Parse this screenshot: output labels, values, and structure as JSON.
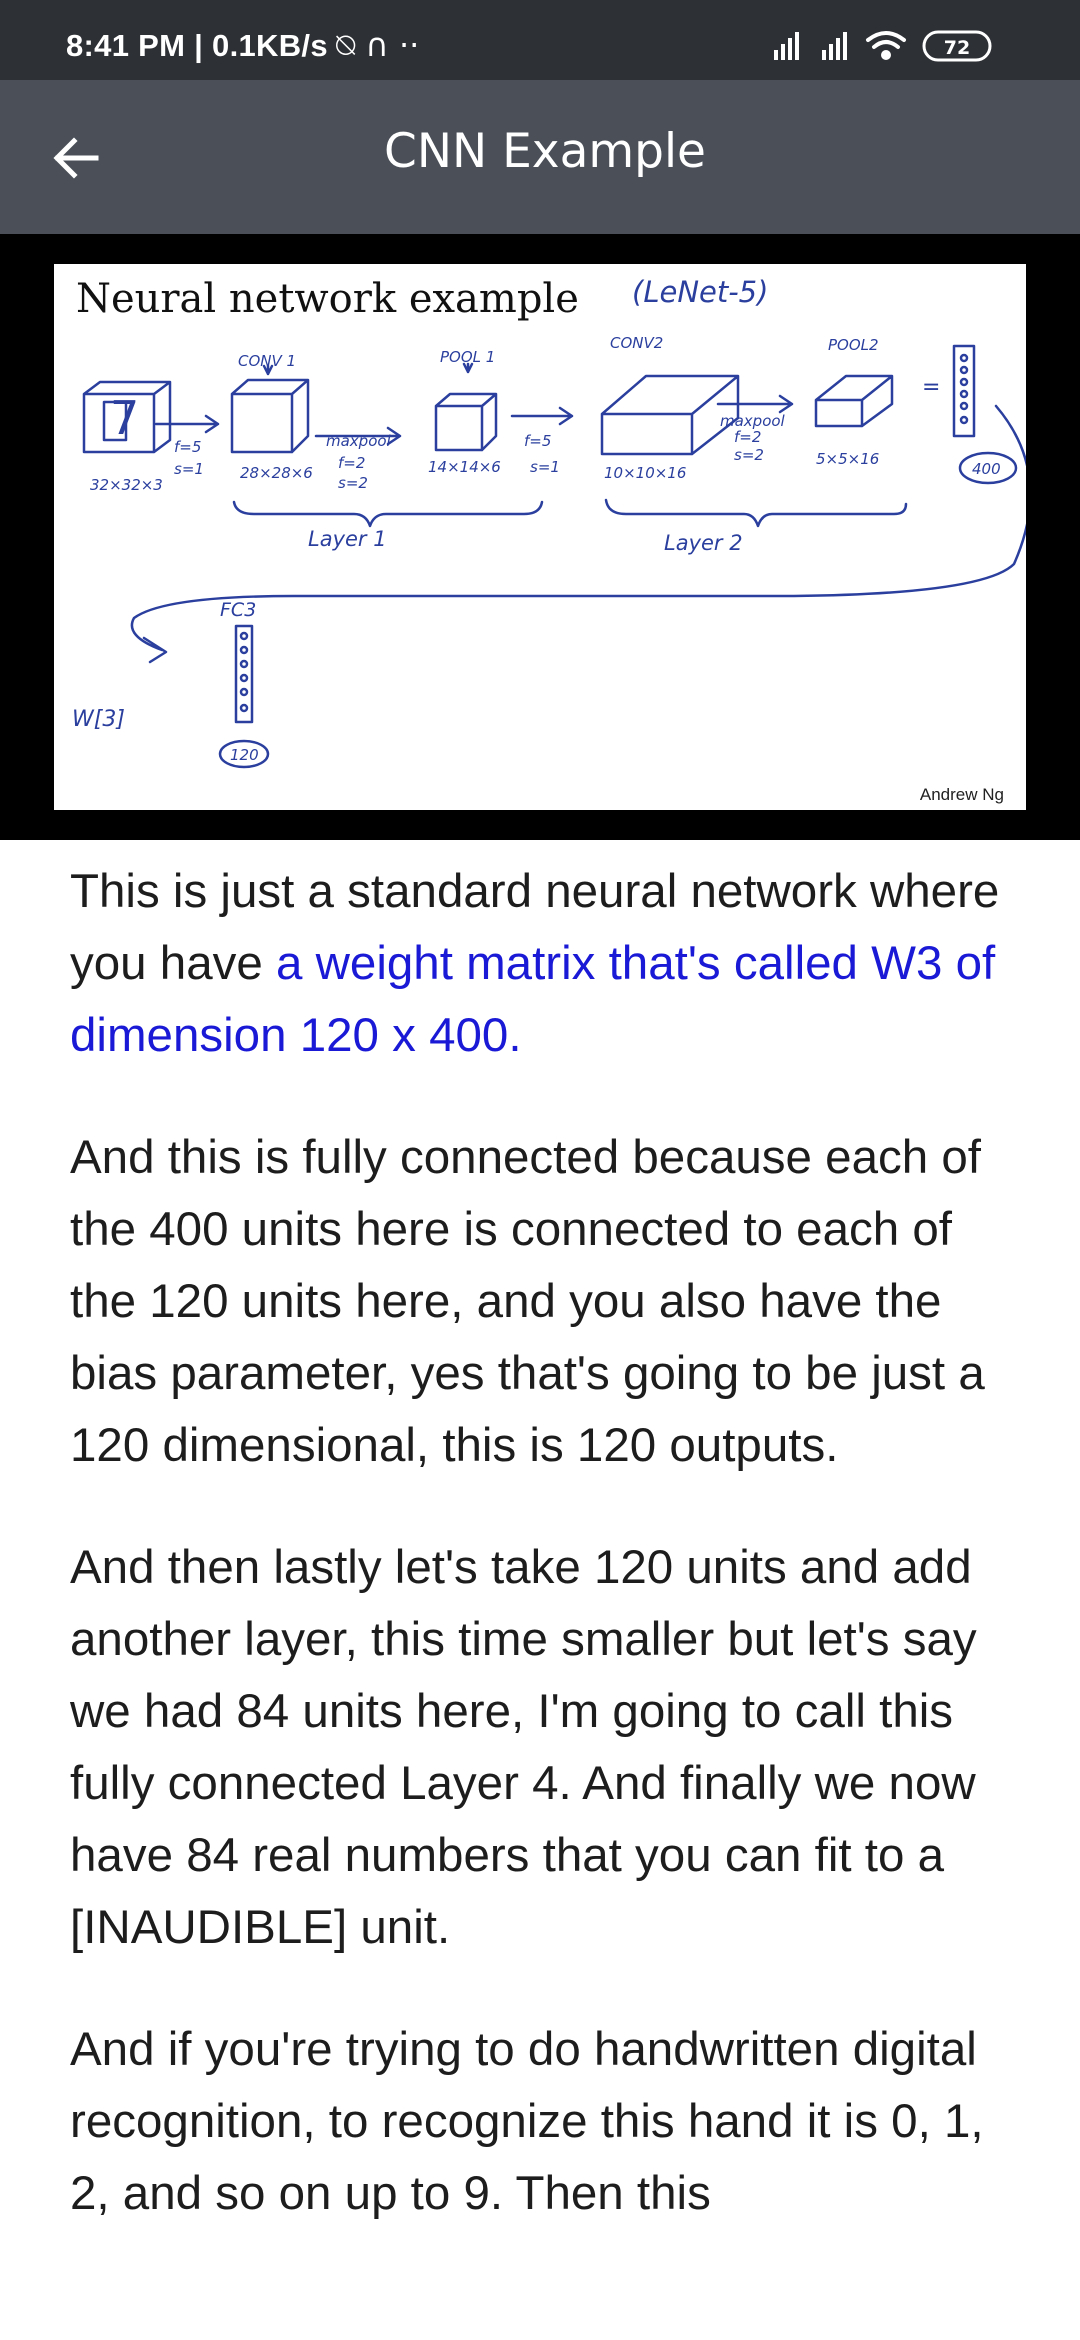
{
  "status_bar": {
    "time": "8:41 PM | 0.1KB/s",
    "glyphs": "⍉ ∩ ··",
    "battery": "72"
  },
  "app_bar": {
    "title": "CNN Example",
    "back_icon": "arrow-left-icon"
  },
  "slide": {
    "title": "Neural network example",
    "subtitle": "(LeNet-5)",
    "credit": "Andrew Ng",
    "labels": {
      "conv1": "CONV 1",
      "pool1": "POOL 1",
      "conv2": "CONV2",
      "pool2": "POOL2",
      "input_digit": "7",
      "input_dims": "32×32×3",
      "f1": "f=5",
      "s1": "s=1",
      "conv1_dims": "28×28×6",
      "maxpool1": "maxpool",
      "mp1_f": "f=2",
      "mp1_s": "s=2",
      "pool1_dims": "14×14×6",
      "f2": "f=5",
      "s2": "s=1",
      "conv2_dims": "10×10×16",
      "maxpool2": "maxpool",
      "mp2_f": "f=2",
      "mp2_s": "s=2",
      "pool2_dims": "5×5×16",
      "equals": "=",
      "units_400": "400",
      "layer1": "Layer 1",
      "layer2": "Layer 2",
      "fc3": "FC3",
      "units_120": "120",
      "w3": "W[3]"
    }
  },
  "transcript": {
    "p1_before": "This is just a standard neural network where you have ",
    "p1_highlight": "a weight matrix that's called W3 of dimension 120 x 400.",
    "p2": "And this is fully connected because each of the 400 units here is connected to each of the 120 units here, and you also have the bias parameter, yes that's going to be just a 120 dimensional, this is 120 outputs.",
    "p3": "And then lastly let's take 120 units and add another layer, this time smaller but let's say we had 84 units here, I'm going to call this fully connected Layer 4. And finally we now have 84 real numbers that you can fit to a [INAUDIBLE] unit.",
    "p4": "And if you're trying to do handwritten digital recognition, to recognize this hand it is 0, 1, 2, and so on up to 9. Then this"
  }
}
